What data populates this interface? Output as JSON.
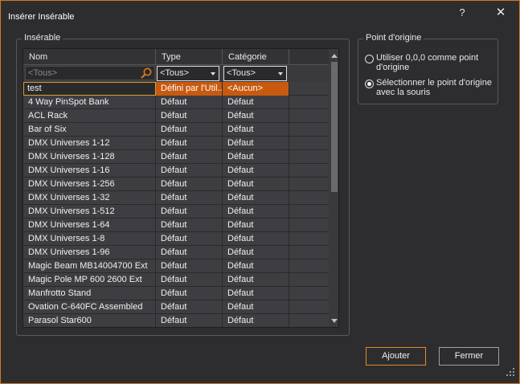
{
  "window": {
    "title": "Insérer Insérable",
    "help_label": "?",
    "close_label": "✕"
  },
  "insertable_group": {
    "legend": "Insérable",
    "columns": [
      "Nom",
      "Type",
      "Catégorie"
    ],
    "filter": {
      "search_placeholder": "<Tous>",
      "type_value": "<Tous>",
      "category_value": "<Tous>"
    },
    "new_row": {
      "name": "test",
      "type": "Défini par l'Util...",
      "category": "<Aucun>"
    },
    "rows": [
      {
        "name": "4 Way PinSpot Bank",
        "type": "Défaut",
        "category": "Défaut"
      },
      {
        "name": "ACL Rack",
        "type": "Défaut",
        "category": "Défaut"
      },
      {
        "name": "Bar of Six",
        "type": "Défaut",
        "category": "Défaut"
      },
      {
        "name": "DMX Universes 1-12",
        "type": "Défaut",
        "category": "Défaut"
      },
      {
        "name": "DMX Universes 1-128",
        "type": "Défaut",
        "category": "Défaut"
      },
      {
        "name": "DMX Universes 1-16",
        "type": "Défaut",
        "category": "Défaut"
      },
      {
        "name": "DMX Universes 1-256",
        "type": "Défaut",
        "category": "Défaut"
      },
      {
        "name": "DMX Universes 1-32",
        "type": "Défaut",
        "category": "Défaut"
      },
      {
        "name": "DMX Universes 1-512",
        "type": "Défaut",
        "category": "Défaut"
      },
      {
        "name": "DMX Universes 1-64",
        "type": "Défaut",
        "category": "Défaut"
      },
      {
        "name": "DMX Universes 1-8",
        "type": "Défaut",
        "category": "Défaut"
      },
      {
        "name": "DMX Universes 1-96",
        "type": "Défaut",
        "category": "Défaut"
      },
      {
        "name": "Magic Beam MB14004700 Ext",
        "type": "Défaut",
        "category": "Défaut"
      },
      {
        "name": "Magic Pole MP 600 2600 Ext",
        "type": "Défaut",
        "category": "Défaut"
      },
      {
        "name": "Manfrotto Stand",
        "type": "Défaut",
        "category": "Défaut"
      },
      {
        "name": "Ovation C-640FC Assembled",
        "type": "Défaut",
        "category": "Défaut"
      },
      {
        "name": "Parasol Star600",
        "type": "Défaut",
        "category": "Défaut"
      }
    ]
  },
  "origin_group": {
    "legend": "Point d'origine",
    "options": [
      {
        "label_line1": "Utiliser 0,0,0 comme point",
        "label_line2": "d'origine",
        "selected": false
      },
      {
        "label_line1": "Sélectionner le point d'origine",
        "label_line2": "avec la souris",
        "selected": true
      }
    ]
  },
  "buttons": {
    "add": "Ajouter",
    "close": "Fermer"
  },
  "colors": {
    "accent": "#d27a1a",
    "selected_row": "#c85a10",
    "background": "#2d2d30"
  }
}
